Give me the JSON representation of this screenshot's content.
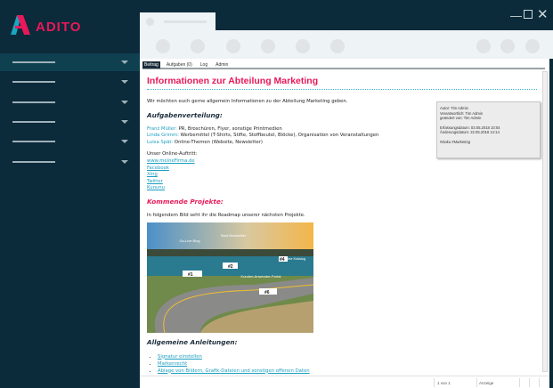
{
  "app": {
    "logo_text": "ADITO",
    "brand_color": "#e8185a",
    "window_controls": [
      "minimize-icon",
      "maximize-icon",
      "close-icon"
    ]
  },
  "sidebar": {
    "items": [
      {
        "active": true
      },
      {
        "active": false
      },
      {
        "active": false
      },
      {
        "active": false
      },
      {
        "active": false
      },
      {
        "active": false
      }
    ]
  },
  "tabs": [
    {
      "label": "Beitrag",
      "active": true
    },
    {
      "label": "Aufgaben (0)"
    },
    {
      "label": "Log"
    },
    {
      "label": "Admin"
    }
  ],
  "doc": {
    "title": "Informationen zur Abteilung Marketing",
    "intro": "Wir möchten euch gerne allgemein Informationen zu der Abteilung Marketing geben.",
    "h_tasks": "Aufgabenverteilung:",
    "tasks": [
      {
        "name": "Franz Müller:",
        "text": " PR, Broschüren, Flyer, sonstige Printmedien"
      },
      {
        "name": "Linda Grimm:",
        "text": " Werbemittel (T-Shirts, Stifte, Stoffbeutel, Blöcke), Organisation von Veranstaltungen"
      },
      {
        "name": "Luisa Spät:",
        "text": " Online-Themen (Website, Newsletter)"
      }
    ],
    "online_label": "Unser Online-Auftritt:",
    "links": [
      "www.meineFirma.de",
      "Facebook",
      "Xing",
      "Twitter",
      "Kununu"
    ],
    "h_projects": "Kommende Projekte:",
    "projects_intro": "In folgendem Bild seht ihr die Roadmap unserer nächsten Projekte.",
    "roadmap_labels": [
      "Go-Live Blog",
      "Start Newsletter",
      "Online Katalog",
      "Kunden-Anwender-Portal",
      "#1",
      "#2",
      "#4",
      "#6"
    ],
    "h_guides": "Allgemeine Anleitungen:",
    "guides": [
      "Signatur einstellen",
      "Markenrecht",
      "Ablage von Bildern, Grafik-Dateien und sonstigen offenen Daten"
    ]
  },
  "info": {
    "author": "Autor: Tim Admin",
    "responsible": "Verantwortlich: Tim Admin",
    "changed_by": "geändert von: Tim Admin",
    "created": "Erfassungsdatum: 03.05.2018 10:04",
    "modified": "Änderungsdatum: 22.05.2018 14:14",
    "tags": "#Doku #Marketing"
  },
  "status": {
    "page": "1 von 1",
    "mode": "Anzeige"
  }
}
